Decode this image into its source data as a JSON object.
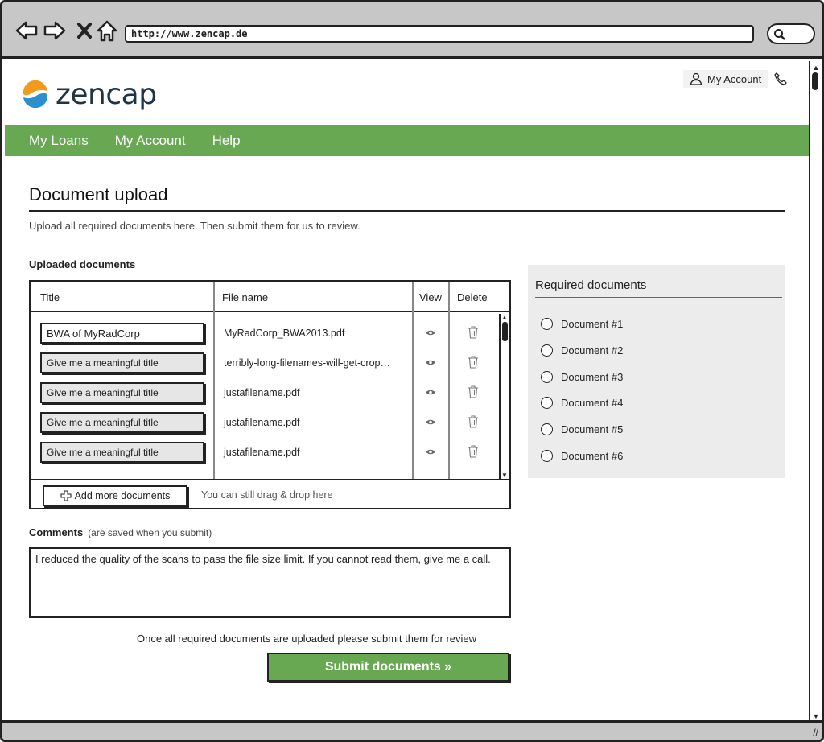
{
  "browser": {
    "url": "http://www.zencap.de"
  },
  "site": {
    "logo_text": "zencap",
    "account_label": "My Account"
  },
  "nav": {
    "items": [
      "My Loans",
      "My Account",
      "Help"
    ]
  },
  "page": {
    "title": "Document upload",
    "subtitle": "Upload all required documents here. Then submit them for us to review."
  },
  "uploaded": {
    "section_label": "Uploaded documents",
    "columns": [
      "Title",
      "File name",
      "View",
      "Delete"
    ],
    "rows": [
      {
        "title": "BWA of MyRadCorp",
        "file": "MyRadCorp_BWA2013.pdf"
      },
      {
        "title": "Give me a meaningful title",
        "file": "terribly-long-filenames-will-get-crop…"
      },
      {
        "title": "Give me a meaningful title",
        "file": "justafilename.pdf"
      },
      {
        "title": "Give me a meaningful title",
        "file": "justafilename.pdf"
      },
      {
        "title": "Give me a meaningful title",
        "file": "justafilename.pdf"
      }
    ],
    "add_button": "Add more documents",
    "drag_hint": "You can still drag & drop here"
  },
  "comments": {
    "label": "Comments",
    "note": "(are saved when you submit)",
    "value": "I reduced the quality of the scans to pass the file size limit. If you cannot read them, give me a call."
  },
  "submit": {
    "hint": "Once all required documents are uploaded please submit them for review",
    "button": "Submit documents »"
  },
  "required": {
    "title": "Required documents",
    "items": [
      "Document #1",
      "Document #2",
      "Document #3",
      "Document #4",
      "Document #5",
      "Document #6"
    ]
  },
  "colors": {
    "accent_green": "#68a853",
    "chrome_gray": "#c7c7c7",
    "logo_blue": "#1f3547",
    "logo_orange": "#f39a1e"
  },
  "icons": [
    "back-arrow-icon",
    "forward-arrow-icon",
    "close-icon",
    "home-icon",
    "search-icon",
    "user-icon",
    "phone-icon",
    "eye-icon",
    "trash-icon",
    "plus-icon",
    "radio-icon"
  ]
}
